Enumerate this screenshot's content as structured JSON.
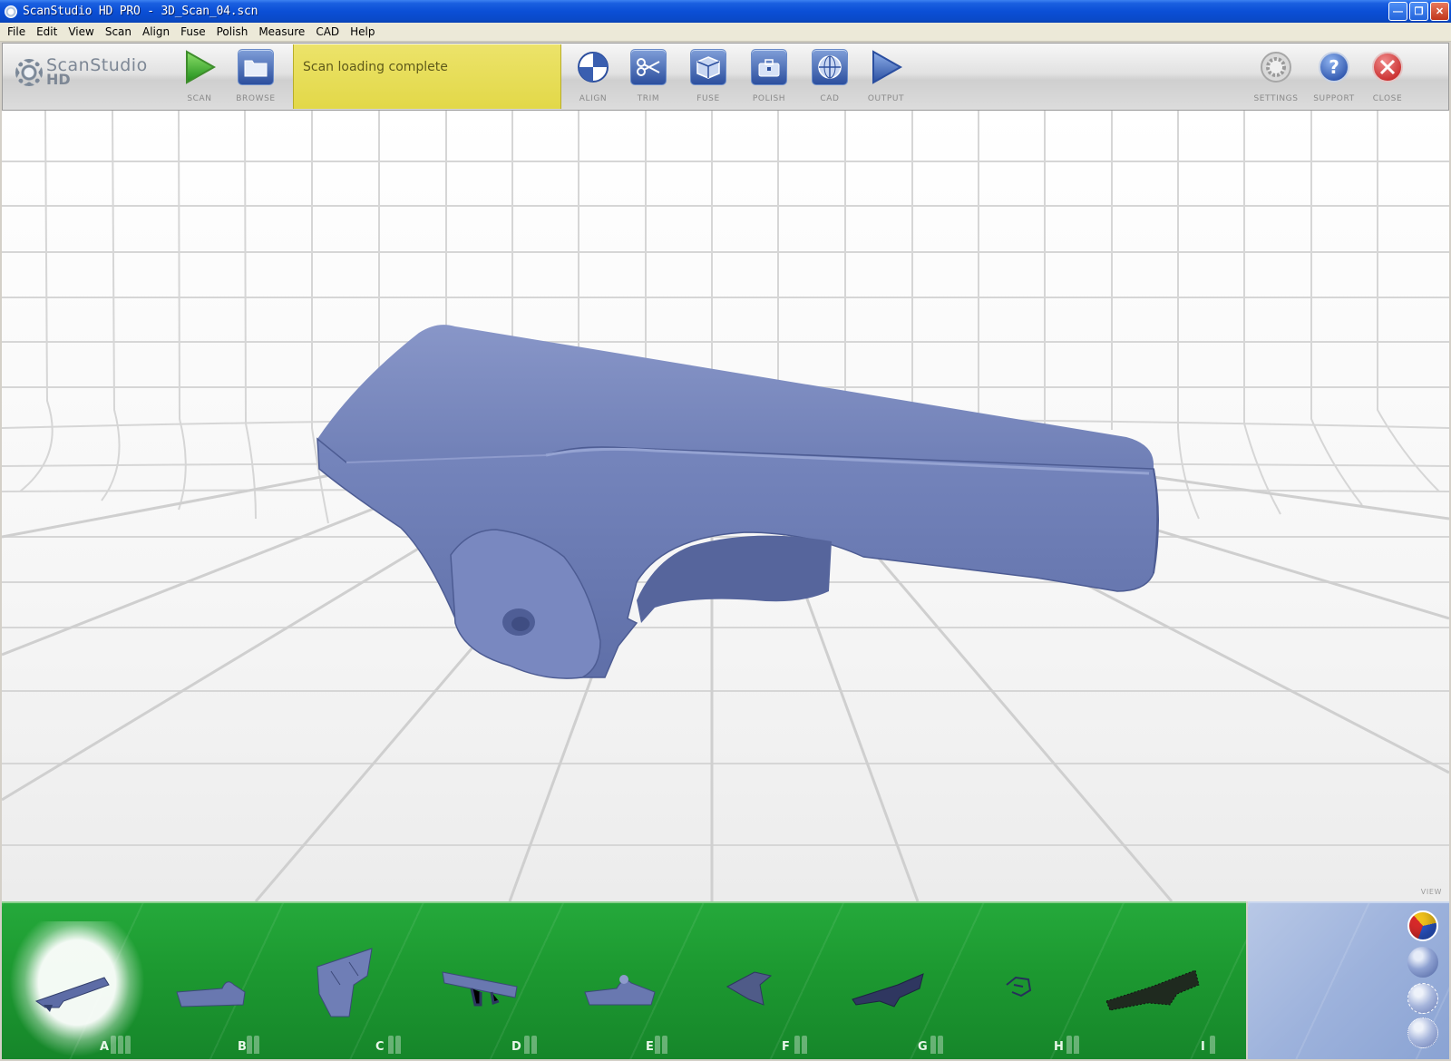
{
  "window": {
    "title": "ScanStudio HD PRO - 3D_Scan_04.scn"
  },
  "menu": {
    "items": [
      {
        "label": "File"
      },
      {
        "label": "Edit"
      },
      {
        "label": "View"
      },
      {
        "label": "Scan"
      },
      {
        "label": "Align"
      },
      {
        "label": "Fuse"
      },
      {
        "label": "Polish"
      },
      {
        "label": "Measure"
      },
      {
        "label": "CAD"
      },
      {
        "label": "Help"
      }
    ]
  },
  "logo": {
    "line1": "ScanStudio",
    "line2": "HD"
  },
  "toolbar": {
    "scan": "Scan",
    "browse": "Browse",
    "align": "Align",
    "trim": "Trim",
    "fuse": "Fuse",
    "polish": "Polish",
    "cad": "CAD",
    "output": "Output",
    "settings": "Settings",
    "support": "Support",
    "close": "Close"
  },
  "status": {
    "message": "Scan loading complete"
  },
  "viewport": {
    "label": "VIEW",
    "model_color": "#6f7fb4"
  },
  "thumbnails": [
    {
      "letter": "A",
      "selected": true
    },
    {
      "letter": "B"
    },
    {
      "letter": "C"
    },
    {
      "letter": "D"
    },
    {
      "letter": "E"
    },
    {
      "letter": "F"
    },
    {
      "letter": "G"
    },
    {
      "letter": "H"
    },
    {
      "letter": "I"
    }
  ],
  "colors": {
    "accent_green": "#1d9a31",
    "status_yellow": "#e2d848",
    "title_blue": "#0b4fd6"
  }
}
